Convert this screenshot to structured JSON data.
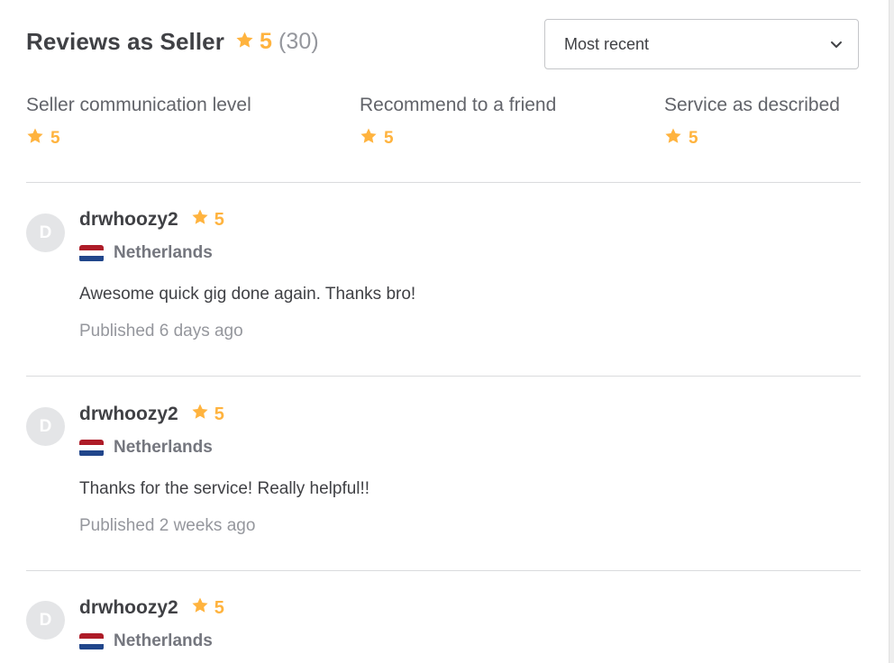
{
  "header": {
    "title": "Reviews as Seller",
    "rating": "5",
    "count": "(30)",
    "sort_label": "Most recent"
  },
  "breakdown": [
    {
      "label": "Seller communication level",
      "rating": "5"
    },
    {
      "label": "Recommend to a friend",
      "rating": "5"
    },
    {
      "label": "Service as described",
      "rating": "5"
    }
  ],
  "reviews": [
    {
      "avatar": "D",
      "username": "drwhoozy2",
      "rating": "5",
      "country": "Netherlands",
      "text": "Awesome quick gig done again. Thanks bro!",
      "published": "Published 6 days ago"
    },
    {
      "avatar": "D",
      "username": "drwhoozy2",
      "rating": "5",
      "country": "Netherlands",
      "text": "Thanks for the service! Really helpful!!",
      "published": "Published 2 weeks ago"
    },
    {
      "avatar": "D",
      "username": "drwhoozy2",
      "rating": "5",
      "country": "Netherlands",
      "text": "",
      "published": ""
    }
  ],
  "colors": {
    "star": "#ffb33e",
    "text": "#404145",
    "muted": "#95979d",
    "divider": "#dadbdd"
  },
  "icons": {
    "rating": "star-icon",
    "sort": "chevron-down-icon",
    "flag": "netherlands-flag-icon"
  }
}
